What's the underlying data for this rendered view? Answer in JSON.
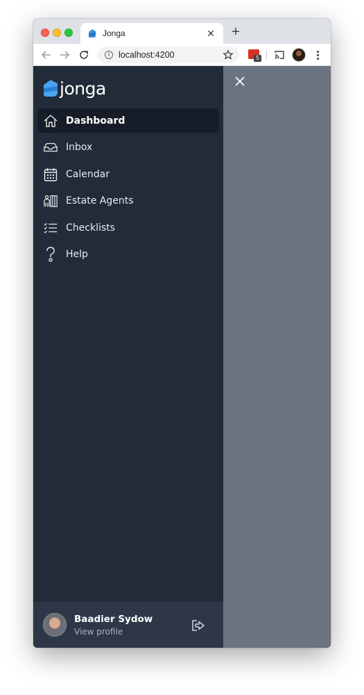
{
  "browser": {
    "tab_title": "Jonga",
    "tab_close_icon": "close-icon",
    "new_tab_icon": "plus-icon",
    "url": "localhost:4200",
    "extension_badge": "5",
    "colors": {
      "tab_strip": "#dee1e6",
      "extension": "#d93025"
    }
  },
  "app": {
    "logo_text": "jonga",
    "colors": {
      "sidebar": "#222b38",
      "active_item": "#161d28",
      "profile_bar": "#2d3748",
      "overlay": "#6b7280",
      "brand": "#3b8fe0"
    },
    "nav": [
      {
        "label": "Dashboard",
        "icon": "home-icon",
        "active": true
      },
      {
        "label": "Inbox",
        "icon": "inbox-icon",
        "active": false
      },
      {
        "label": "Calendar",
        "icon": "calendar-icon",
        "active": false
      },
      {
        "label": "Estate Agents",
        "icon": "estate-agents-icon",
        "active": false
      },
      {
        "label": "Checklists",
        "icon": "checklist-icon",
        "active": false
      },
      {
        "label": "Help",
        "icon": "help-icon",
        "active": false
      }
    ],
    "profile": {
      "name": "Baadier Sydow",
      "link": "View profile",
      "logout_icon": "logout-icon"
    },
    "close_icon": "close-icon"
  }
}
